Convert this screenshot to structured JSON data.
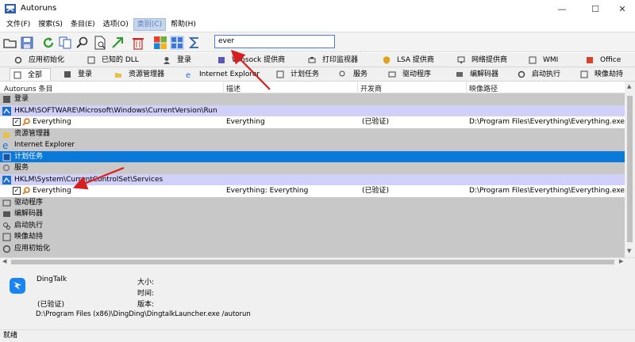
{
  "window": {
    "title": "Autoruns",
    "minimize": "—",
    "maximize": "☐",
    "close": "✕"
  },
  "menu": [
    "文件(F)",
    "搜索(S)",
    "条目(E)",
    "选项(O)",
    "类别(C)",
    "帮助(H)"
  ],
  "filter": {
    "value": "ever"
  },
  "tabs_row1": [
    "应用初始化",
    "已知的 DLL",
    "登录",
    "Winsock 提供商",
    "打印监视器",
    "LSA 提供商",
    "网络提供商",
    "WMI",
    "Office"
  ],
  "tabs_row2": [
    "全部",
    "登录",
    "资源管理器",
    "Internet Explorer",
    "计划任务",
    "服务",
    "驱动程序",
    "编解码器",
    "启动执行",
    "映像劫持"
  ],
  "columns": [
    "Autoruns 条目",
    "描述",
    "开发商",
    "映像路径"
  ],
  "rows": [
    {
      "kind": "cat",
      "label": "登录"
    },
    {
      "kind": "key",
      "label": "HKLM\\SOFTWARE\\Microsoft\\Windows\\CurrentVersion\\Run"
    },
    {
      "kind": "entry",
      "label": "Everything",
      "desc": "Everything",
      "publisher": "(已验证)",
      "path": "D:\\Program Files\\Everything\\Everything.exe"
    },
    {
      "kind": "cat",
      "label": "资源管理器"
    },
    {
      "kind": "cat",
      "label": "Internet Explorer"
    },
    {
      "kind": "sel",
      "label": "计划任务"
    },
    {
      "kind": "cat",
      "label": "服务"
    },
    {
      "kind": "key",
      "label": "HKLM\\System\\CurrentControlSet\\Services"
    },
    {
      "kind": "entry",
      "label": "Everything",
      "desc": "Everything: Everything",
      "publisher": "(已验证)",
      "path": "D:\\Program Files\\Everything\\Everything.exe"
    },
    {
      "kind": "cat",
      "label": "驱动程序"
    },
    {
      "kind": "cat",
      "label": "编解码器"
    },
    {
      "kind": "cat",
      "label": "启动执行"
    },
    {
      "kind": "cat",
      "label": "映像劫持"
    },
    {
      "kind": "cat",
      "label": "应用初始化"
    }
  ],
  "detail": {
    "name": "DingTalk",
    "verified": "(已验证)",
    "size_label": "大小:",
    "time_label": "时间:",
    "version_label": "版本:",
    "command": "D:\\Program Files (x86)\\DingDing\\DingtalkLauncher.exe /autorun"
  },
  "status": "就绪",
  "colors": {
    "selected": "#0a7ad8",
    "category": "#c8c8c8",
    "key": "#d0d0f8",
    "arrow": "#d42020"
  }
}
